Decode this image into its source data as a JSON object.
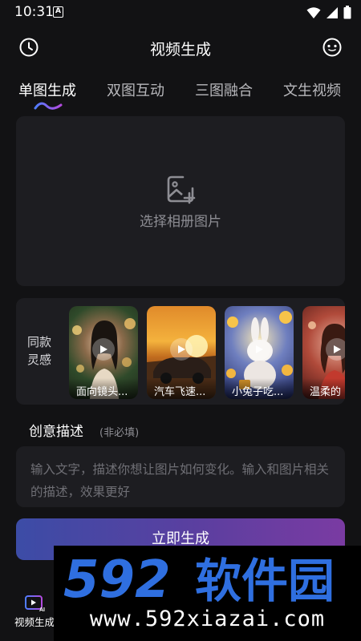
{
  "status_bar": {
    "time": "10:31",
    "a_badge": "A"
  },
  "header": {
    "title": "视频生成",
    "history_icon": "clock-icon",
    "menu_icon": "more-circle-icon"
  },
  "tabs": [
    {
      "label": "单图生成",
      "active": true
    },
    {
      "label": "双图互动",
      "active": false
    },
    {
      "label": "三图融合",
      "active": false
    },
    {
      "label": "文生视频",
      "active": false
    }
  ],
  "upload": {
    "label": "选择相册图片",
    "icon": "image-add-icon"
  },
  "inspiration": {
    "label": "同款\n灵感",
    "cards": [
      {
        "caption": "面向镜头...",
        "theme": "girl-flowers"
      },
      {
        "caption": "汽车飞速...",
        "theme": "car-sunset"
      },
      {
        "caption": "小兔子吃...",
        "theme": "rabbit-moon"
      },
      {
        "caption": "温柔的",
        "theme": "girl-red"
      }
    ]
  },
  "description": {
    "title": "创意描述",
    "optional": "(非必填)",
    "placeholder": "输入文字，描述你想让图片如何变化。输入和图片相关的描述，效果更好"
  },
  "generate_button": {
    "label": "立即生成"
  },
  "bottom_nav": {
    "items": [
      {
        "label": "视频生成",
        "icon": "video-ai-icon",
        "active": true
      }
    ]
  },
  "watermark": {
    "brand": "592软件园",
    "url": "www.592xiazai.com"
  },
  "colors": {
    "background": "#121214",
    "panel": "#1d1d21",
    "button_start": "#3c4ca6",
    "button_end": "#7a3ba2",
    "watermark_blue": "#2f6fe0"
  }
}
